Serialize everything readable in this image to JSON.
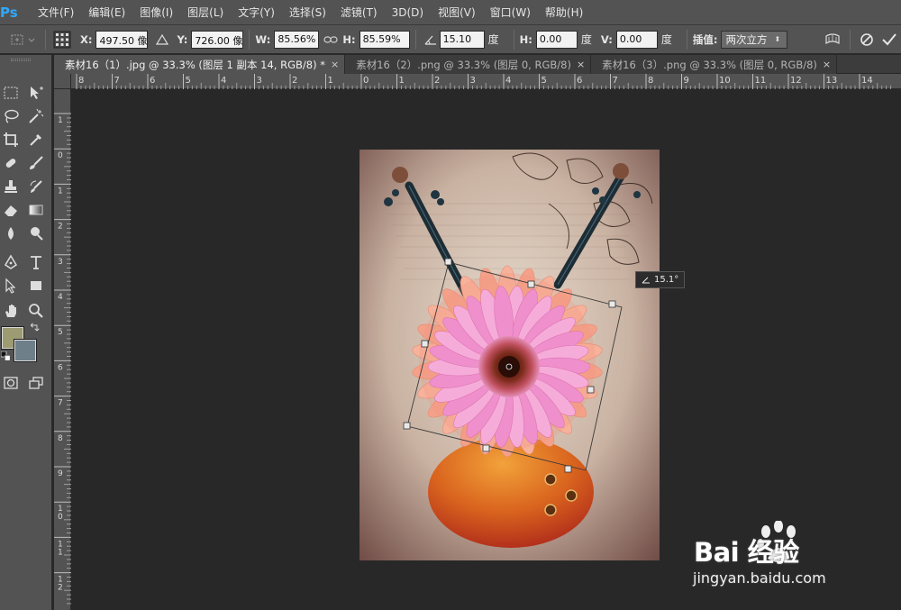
{
  "app": {
    "logo_text": "Ps",
    "accent_color": "#31a8ff"
  },
  "menu": {
    "items": [
      {
        "label": "文件(F)"
      },
      {
        "label": "编辑(E)"
      },
      {
        "label": "图像(I)"
      },
      {
        "label": "图层(L)"
      },
      {
        "label": "文字(Y)"
      },
      {
        "label": "选择(S)"
      },
      {
        "label": "滤镜(T)"
      },
      {
        "label": "3D(D)"
      },
      {
        "label": "视图(V)"
      },
      {
        "label": "窗口(W)"
      },
      {
        "label": "帮助(H)"
      }
    ]
  },
  "options": {
    "x_label": "X:",
    "x_value": "497.50 像",
    "y_label": "Y:",
    "y_value": "726.00 像",
    "w_label": "W:",
    "w_value": "85.56%",
    "h_label": "H:",
    "h_value": "85.59%",
    "angle_value": "15.10",
    "angle_unit": "度",
    "hskew_label": "H:",
    "hskew_value": "0.00",
    "hskew_unit": "度",
    "vskew_label": "V:",
    "vskew_value": "0.00",
    "vskew_unit": "度",
    "interp_label": "插值:",
    "interp_value": "两次立方"
  },
  "tabs": [
    {
      "label": "素材16（1）.jpg @ 33.3% (图层 1 副本 14, RGB/8) *",
      "active": true
    },
    {
      "label": "素材16（2）.png @ 33.3% (图层 0, RGB/8)",
      "active": false
    },
    {
      "label": "素材16（3）.png @ 33.3% (图层 0, RGB/8)",
      "active": false
    }
  ],
  "tab_close_glyph": "×",
  "ruler": {
    "top_labels": [
      "8",
      "7",
      "6",
      "5",
      "4",
      "3",
      "2",
      "1",
      "0",
      "1",
      "2",
      "3",
      "4",
      "5",
      "6",
      "7",
      "8",
      "9",
      "10",
      "11",
      "12",
      "13",
      "14"
    ],
    "left_labels": [
      "1",
      "0",
      "1",
      "2",
      "3",
      "4",
      "5",
      "6",
      "7",
      "8",
      "9",
      "1\n0",
      "1\n1",
      "1\n2"
    ]
  },
  "colors": {
    "foreground": "#9c9b71",
    "background": "#6e7f8a"
  },
  "angle_tooltip": {
    "value": "15.1°"
  },
  "watermark": {
    "brand": "Bai 经验",
    "url": "jingyan.baidu.com"
  }
}
